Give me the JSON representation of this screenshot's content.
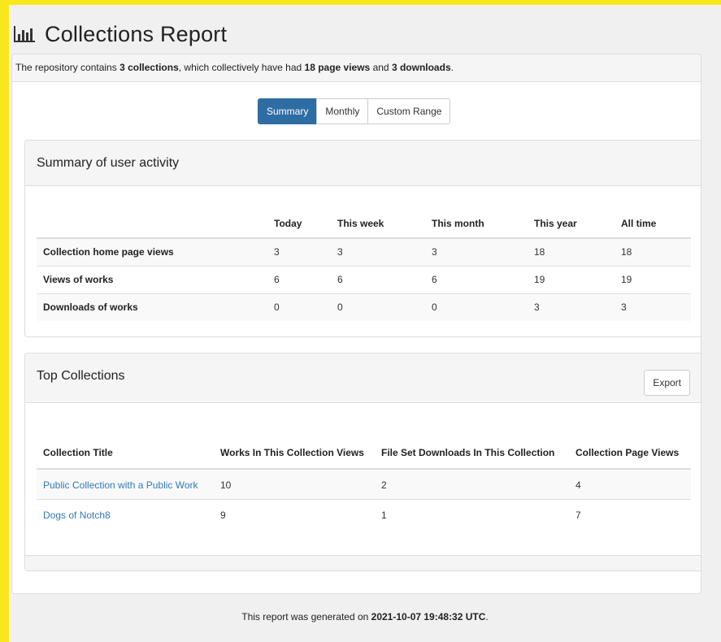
{
  "page_title": "Collections Report",
  "intro": {
    "prefix": "The repository contains ",
    "collections": "3 collections",
    "middle": ", which collectively have had ",
    "page_views": "18 page views",
    "and": " and ",
    "downloads": "3 downloads",
    "suffix": "."
  },
  "tabs": [
    {
      "label": "Summary",
      "active": true
    },
    {
      "label": "Monthly",
      "active": false
    },
    {
      "label": "Custom Range",
      "active": false
    }
  ],
  "summary": {
    "heading": "Summary of user activity",
    "columns": [
      "",
      "Today",
      "This week",
      "This month",
      "This year",
      "All time"
    ],
    "rows": [
      {
        "label": "Collection home page views",
        "values": [
          "3",
          "3",
          "3",
          "18",
          "18"
        ]
      },
      {
        "label": "Views of works",
        "values": [
          "6",
          "6",
          "6",
          "19",
          "19"
        ]
      },
      {
        "label": "Downloads of works",
        "values": [
          "0",
          "0",
          "0",
          "3",
          "3"
        ]
      }
    ]
  },
  "top_collections": {
    "heading": "Top Collections",
    "export_label": "Export",
    "columns": [
      "Collection Title",
      "Works In This Collection Views",
      "File Set Downloads In This Collection",
      "Collection Page Views"
    ],
    "rows": [
      {
        "title": "Public Collection with a Public Work",
        "works_views": "10",
        "downloads": "2",
        "page_views": "4"
      },
      {
        "title": "Dogs of Notch8",
        "works_views": "9",
        "downloads": "1",
        "page_views": "7"
      }
    ]
  },
  "footer": {
    "prefix": "This report was generated on ",
    "timestamp": "2021-10-07 19:48:32 UTC",
    "suffix": "."
  },
  "colors": {
    "background": "#f8e71c",
    "active_tab": "#2e6da4",
    "link": "#337ab7"
  },
  "icons": {
    "title": "bar-chart-icon"
  }
}
